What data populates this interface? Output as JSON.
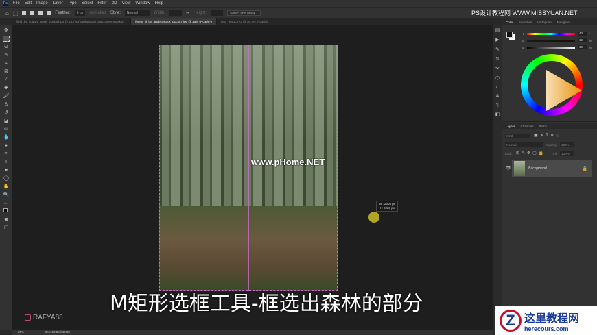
{
  "menu": [
    "File",
    "Edit",
    "Image",
    "Layer",
    "Type",
    "Select",
    "Filter",
    "3D",
    "View",
    "Window",
    "Help"
  ],
  "options": {
    "feather_label": "Feather:",
    "feather_value": "0 px",
    "antialias": "Anti-alias",
    "style_label": "Style:",
    "style_value": "Normal",
    "width_label": "Width:",
    "height_label": "Height:",
    "select_mask": "Select and Mask..."
  },
  "tabs": [
    "field_by_sugary_stock_d1ex0d.jpg @ 16.7% (Background copy, Layer Mask/8) *",
    "forest_iii_by_andeksstock_d1c4u7.jpg @ 25% (RGB/8*)",
    "IMG_9951.JPG @ 16.7% (RGB/8)"
  ],
  "site_watermark": "PS设计教程网 WWW.MISSYUAN.NET",
  "canvas": {
    "watermark": "www.pHome.NET",
    "size_readout": {
      "w": "W :  2304 px",
      "h": "H :  2228 px"
    },
    "subtitle": "M矩形选框工具-框选出森林的部分",
    "instagram": "RAFYA88"
  },
  "status": {
    "zoom": "25%",
    "doc": "Doc: 22.8M/22.8M"
  },
  "color_panel": {
    "tabs": [
      "Color",
      "Swatches",
      "Histogram",
      "Navigator"
    ],
    "h": {
      "label": "H",
      "value": "40",
      "unit": "°"
    },
    "s": {
      "label": "S",
      "value": "12",
      "unit": "%"
    },
    "b": {
      "label": "B",
      "value": "10",
      "unit": "%"
    }
  },
  "layers_panel": {
    "tabs": [
      "Layers",
      "Channels",
      "Paths"
    ],
    "kind": "Kind",
    "blend": "Normal",
    "opacity_label": "Opacity:",
    "opacity": "100%",
    "lock_label": "Lock:",
    "fill_label": "Fill:",
    "fill": "100%",
    "layer_name": "Background"
  },
  "logo": {
    "title": "这里教程网",
    "url": "herecours.com"
  }
}
